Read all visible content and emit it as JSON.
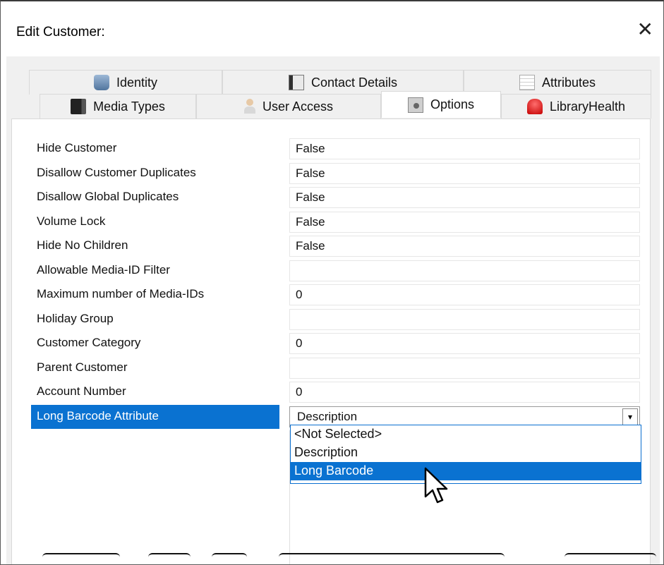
{
  "window": {
    "title": "Edit Customer:",
    "close_glyph": "✕"
  },
  "tabs": {
    "row_back": [
      {
        "label": "Identity",
        "icon": "identity-icon"
      },
      {
        "label": "Contact Details",
        "icon": "contact-details-icon"
      },
      {
        "label": "Attributes",
        "icon": "attributes-icon"
      }
    ],
    "row_front": [
      {
        "label": "Media Types",
        "icon": "media-types-icon"
      },
      {
        "label": "User Access",
        "icon": "user-access-icon"
      },
      {
        "label": "Options",
        "icon": "options-icon",
        "active": true
      },
      {
        "label": "LibraryHealth",
        "icon": "library-health-icon"
      }
    ]
  },
  "properties": [
    {
      "name": "Hide Customer",
      "value": "False"
    },
    {
      "name": "Disallow Customer Duplicates",
      "value": "False"
    },
    {
      "name": "Disallow Global Duplicates",
      "value": "False"
    },
    {
      "name": "Volume Lock",
      "value": "False"
    },
    {
      "name": "Hide No Children",
      "value": "False"
    },
    {
      "name": "Allowable Media-ID Filter",
      "value": ""
    },
    {
      "name": "Maximum number of Media-IDs",
      "value": "0"
    },
    {
      "name": "Holiday Group",
      "value": ""
    },
    {
      "name": "Customer Category",
      "value": "0"
    },
    {
      "name": "Parent Customer",
      "value": ""
    },
    {
      "name": "Account Number",
      "value": "0"
    },
    {
      "name": "Long Barcode Attribute",
      "value": "Description",
      "selected": true
    }
  ],
  "dropdown": {
    "arrow_glyph": "▾",
    "options": [
      "<Not Selected>",
      "Description",
      "Long Barcode"
    ],
    "highlighted": "Long Barcode"
  },
  "colors": {
    "selection": "#0a72d1",
    "dropdown_border": "#0a6fd0"
  }
}
